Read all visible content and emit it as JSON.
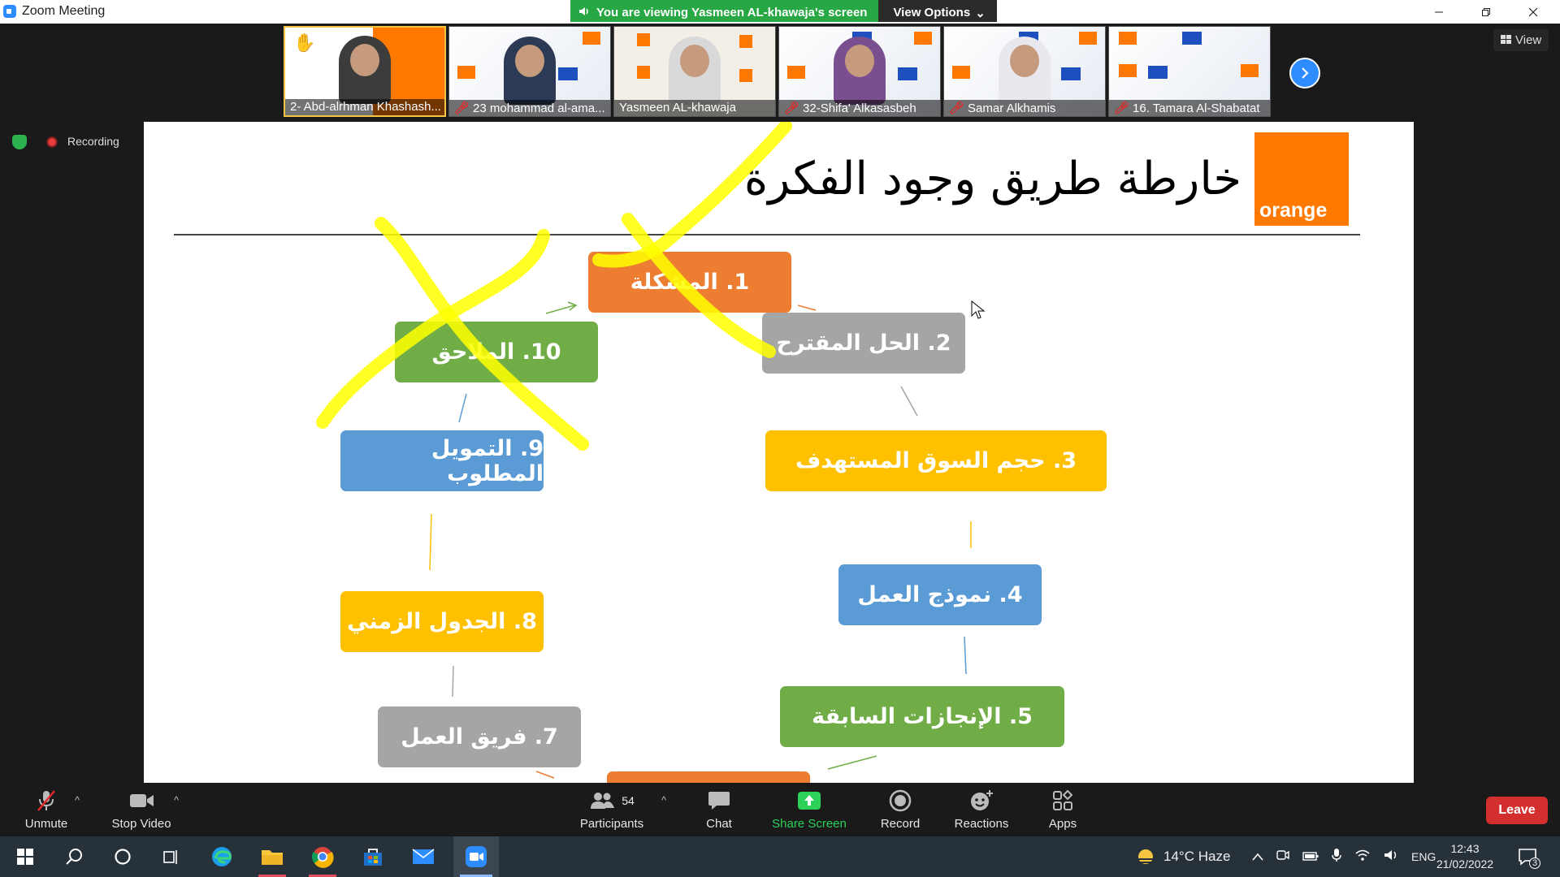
{
  "window": {
    "title": "Zoom Meeting",
    "share_banner": "You are viewing Yasmeen AL-khawaja's screen",
    "view_options": "View Options",
    "view_button": "View"
  },
  "participants_strip": [
    {
      "name": "2- Abd-alrhman Khashash...",
      "muted": false,
      "active": true
    },
    {
      "name": "23 mohammad al-ama...",
      "muted": true,
      "active": false
    },
    {
      "name": "Yasmeen AL-khawaja",
      "muted": false,
      "active": false
    },
    {
      "name": "32-Shifa' Alkasasbeh",
      "muted": true,
      "active": false
    },
    {
      "name": "Samar Alkhamis",
      "muted": true,
      "active": false
    },
    {
      "name": "16. Tamara Al-Shabatat",
      "muted": true,
      "active": false
    }
  ],
  "status": {
    "recording": "Recording"
  },
  "slide": {
    "title": "خارطة طريق وجود الفكرة",
    "logo": "orange",
    "steps": [
      {
        "label": "1. المشكلة",
        "color": "#ed7d31"
      },
      {
        "label": "2. الحل المقترح",
        "color": "#a5a5a5"
      },
      {
        "label": "3. حجم السوق المستهدف",
        "color": "#ffc000"
      },
      {
        "label": "4. نموذج العمل",
        "color": "#5b9bd5"
      },
      {
        "label": "5. الإنجازات السابقة",
        "color": "#70ad47"
      },
      {
        "label": "7. فريق العمل",
        "color": "#a5a5a5"
      },
      {
        "label": "8. الجدول الزمني",
        "color": "#ffc000"
      },
      {
        "label": "9. التمويل المطلوب",
        "color": "#5b9bd5"
      },
      {
        "label": "10. الملاحق",
        "color": "#70ad47"
      }
    ]
  },
  "toolbar": {
    "unmute": "Unmute",
    "stop_video": "Stop Video",
    "participants": "Participants",
    "participants_count": "54",
    "chat": "Chat",
    "share_screen": "Share Screen",
    "record": "Record",
    "reactions": "Reactions",
    "apps": "Apps",
    "leave": "Leave"
  },
  "taskbar": {
    "weather": "14°C  Haze",
    "language": "ENG",
    "time": "12:43",
    "date": "21/02/2022",
    "notifications": "3"
  }
}
